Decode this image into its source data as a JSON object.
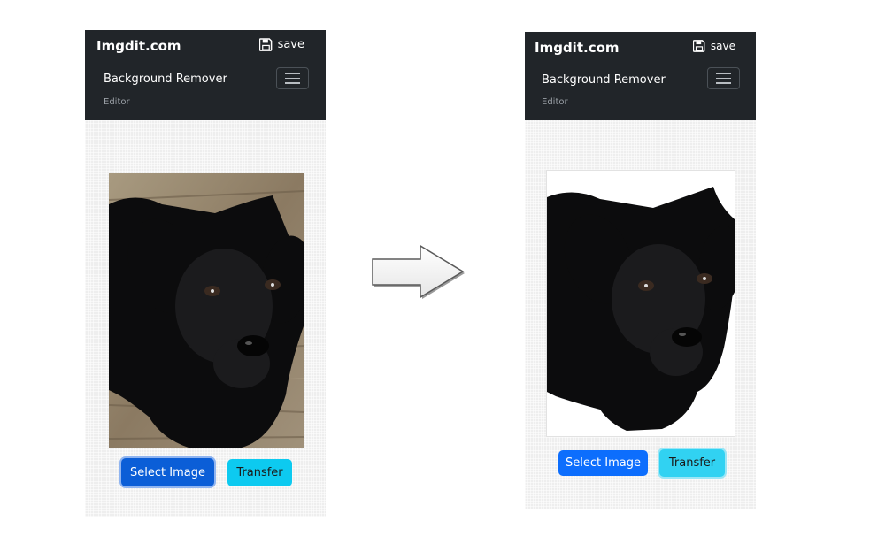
{
  "before_screen": {
    "navbar": {
      "brand": "Imgdit.com",
      "save_label": "save",
      "title": "Background Remover",
      "subtitle": "Editor"
    },
    "buttons": {
      "select_image": "Select Image",
      "transfer": "Transfer"
    },
    "image": "puppy photo with wooden floor background"
  },
  "after_screen": {
    "navbar": {
      "brand": "Imgdit.com",
      "save_label": "save",
      "title": "Background Remover",
      "subtitle": "Editor"
    },
    "buttons": {
      "select_image": "Select Image",
      "transfer": "Transfer"
    },
    "image": "puppy photo with background removed"
  },
  "icons": {
    "save": "floppy-disk-icon",
    "menu": "hamburger-menu-icon",
    "transition": "right-arrow-icon"
  },
  "colors": {
    "navbar": "#212529",
    "primary": "#0d6efd",
    "info": "#0dcaf0"
  }
}
